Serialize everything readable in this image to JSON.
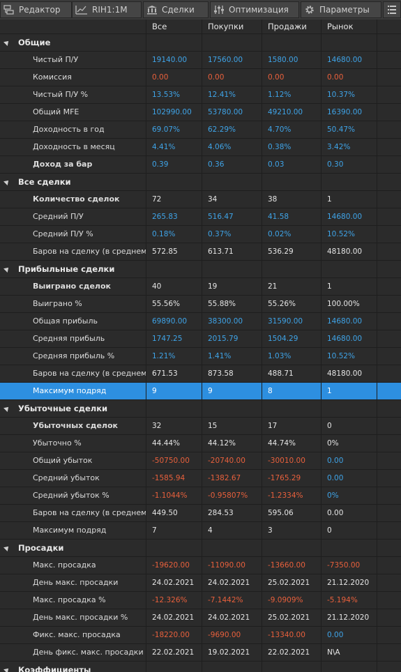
{
  "tabs": [
    {
      "label": "Редактор",
      "icon": "editor-icon"
    },
    {
      "label": "RIH1:1M",
      "icon": "chart-icon"
    },
    {
      "label": "Сделки",
      "icon": "deals-icon"
    },
    {
      "label": "Оптимизация",
      "icon": "optimization-icon"
    },
    {
      "label": "Параметры",
      "icon": "gear-icon"
    }
  ],
  "menu_icon": "list-menu-icon",
  "columns": [
    "",
    "Все",
    "Покупки",
    "Продажи",
    "Рынок"
  ],
  "colors": {
    "positive": "#3fa4e8",
    "negative": "#e8603c",
    "neutral": "#e6e6e6",
    "selection": "#2d8fe0"
  },
  "sections": [
    {
      "title": "Общие",
      "rows": [
        {
          "label": "Чистый П/У",
          "bold": false,
          "values": [
            [
              "19140.00",
              "blue"
            ],
            [
              "17560.00",
              "blue"
            ],
            [
              "1580.00",
              "blue"
            ],
            [
              "14680.00",
              "blue"
            ]
          ]
        },
        {
          "label": "Комиссия",
          "bold": false,
          "values": [
            [
              "0.00",
              "red"
            ],
            [
              "0.00",
              "red"
            ],
            [
              "0.00",
              "red"
            ],
            [
              "0.00",
              "red"
            ]
          ]
        },
        {
          "label": "Чистый П/У %",
          "bold": false,
          "values": [
            [
              "13.53%",
              "blue"
            ],
            [
              "12.41%",
              "blue"
            ],
            [
              "1.12%",
              "blue"
            ],
            [
              "10.37%",
              "blue"
            ]
          ]
        },
        {
          "label": "Общий MFE",
          "bold": false,
          "values": [
            [
              "102990.00",
              "blue"
            ],
            [
              "53780.00",
              "blue"
            ],
            [
              "49210.00",
              "blue"
            ],
            [
              "16390.00",
              "blue"
            ]
          ]
        },
        {
          "label": "Доходность в год",
          "bold": false,
          "values": [
            [
              "69.07%",
              "blue"
            ],
            [
              "62.29%",
              "blue"
            ],
            [
              "4.70%",
              "blue"
            ],
            [
              "50.47%",
              "blue"
            ]
          ]
        },
        {
          "label": "Доходность в месяц",
          "bold": false,
          "values": [
            [
              "4.41%",
              "blue"
            ],
            [
              "4.06%",
              "blue"
            ],
            [
              "0.38%",
              "blue"
            ],
            [
              "3.42%",
              "blue"
            ]
          ]
        },
        {
          "label": "Доход за бар",
          "bold": true,
          "values": [
            [
              "0.39",
              "blue"
            ],
            [
              "0.36",
              "blue"
            ],
            [
              "0.03",
              "blue"
            ],
            [
              "0.30",
              "blue"
            ]
          ]
        }
      ]
    },
    {
      "title": "Все сделки",
      "rows": [
        {
          "label": "Количество сделок",
          "bold": true,
          "values": [
            [
              "72",
              "white"
            ],
            [
              "34",
              "white"
            ],
            [
              "38",
              "white"
            ],
            [
              "1",
              "white"
            ]
          ]
        },
        {
          "label": "Средний П/У",
          "bold": false,
          "values": [
            [
              "265.83",
              "blue"
            ],
            [
              "516.47",
              "blue"
            ],
            [
              "41.58",
              "blue"
            ],
            [
              "14680.00",
              "blue"
            ]
          ]
        },
        {
          "label": "Средний П/У %",
          "bold": false,
          "values": [
            [
              "0.18%",
              "blue"
            ],
            [
              "0.37%",
              "blue"
            ],
            [
              "0.02%",
              "blue"
            ],
            [
              "10.52%",
              "blue"
            ]
          ]
        },
        {
          "label": "Баров на сделку (в среднем)",
          "bold": false,
          "values": [
            [
              "572.85",
              "white"
            ],
            [
              "613.71",
              "white"
            ],
            [
              "536.29",
              "white"
            ],
            [
              "48180.00",
              "white"
            ]
          ]
        }
      ]
    },
    {
      "title": "Прибыльные сделки",
      "rows": [
        {
          "label": "Выиграно сделок",
          "bold": true,
          "values": [
            [
              "40",
              "white"
            ],
            [
              "19",
              "white"
            ],
            [
              "21",
              "white"
            ],
            [
              "1",
              "white"
            ]
          ]
        },
        {
          "label": "Выиграно %",
          "bold": false,
          "values": [
            [
              "55.56%",
              "white"
            ],
            [
              "55.88%",
              "white"
            ],
            [
              "55.26%",
              "white"
            ],
            [
              "100.00%",
              "white"
            ]
          ]
        },
        {
          "label": "Общая прибыль",
          "bold": false,
          "values": [
            [
              "69890.00",
              "blue"
            ],
            [
              "38300.00",
              "blue"
            ],
            [
              "31590.00",
              "blue"
            ],
            [
              "14680.00",
              "blue"
            ]
          ]
        },
        {
          "label": "Средняя прибыль",
          "bold": false,
          "values": [
            [
              "1747.25",
              "blue"
            ],
            [
              "2015.79",
              "blue"
            ],
            [
              "1504.29",
              "blue"
            ],
            [
              "14680.00",
              "blue"
            ]
          ]
        },
        {
          "label": "Средняя прибыль %",
          "bold": false,
          "values": [
            [
              "1.21%",
              "blue"
            ],
            [
              "1.41%",
              "blue"
            ],
            [
              "1.03%",
              "blue"
            ],
            [
              "10.52%",
              "blue"
            ]
          ]
        },
        {
          "label": "Баров на сделку (в среднем)",
          "bold": false,
          "values": [
            [
              "671.53",
              "white"
            ],
            [
              "873.58",
              "white"
            ],
            [
              "488.71",
              "white"
            ],
            [
              "48180.00",
              "white"
            ]
          ]
        },
        {
          "label": "Максимум подряд",
          "bold": false,
          "selected": true,
          "values": [
            [
              "9",
              "white"
            ],
            [
              "9",
              "white"
            ],
            [
              "8",
              "white"
            ],
            [
              "1",
              "white"
            ]
          ]
        }
      ]
    },
    {
      "title": "Убыточные сделки",
      "rows": [
        {
          "label": "Убыточных сделок",
          "bold": true,
          "values": [
            [
              "32",
              "white"
            ],
            [
              "15",
              "white"
            ],
            [
              "17",
              "white"
            ],
            [
              "0",
              "white"
            ]
          ]
        },
        {
          "label": "Убыточно %",
          "bold": false,
          "values": [
            [
              "44.44%",
              "white"
            ],
            [
              "44.12%",
              "white"
            ],
            [
              "44.74%",
              "white"
            ],
            [
              "0%",
              "white"
            ]
          ]
        },
        {
          "label": "Общий убыток",
          "bold": false,
          "values": [
            [
              "-50750.00",
              "red"
            ],
            [
              "-20740.00",
              "red"
            ],
            [
              "-30010.00",
              "red"
            ],
            [
              "0.00",
              "blue"
            ]
          ]
        },
        {
          "label": "Средний убыток",
          "bold": false,
          "values": [
            [
              "-1585.94",
              "red"
            ],
            [
              "-1382.67",
              "red"
            ],
            [
              "-1765.29",
              "red"
            ],
            [
              "0.00",
              "blue"
            ]
          ]
        },
        {
          "label": "Средний убыток %",
          "bold": false,
          "values": [
            [
              "-1.1044%",
              "red"
            ],
            [
              "-0.95807%",
              "red"
            ],
            [
              "-1.2334%",
              "red"
            ],
            [
              "0%",
              "blue"
            ]
          ]
        },
        {
          "label": "Баров на сделку (в среднем)",
          "bold": false,
          "values": [
            [
              "449.50",
              "white"
            ],
            [
              "284.53",
              "white"
            ],
            [
              "595.06",
              "white"
            ],
            [
              "0.00",
              "white"
            ]
          ]
        },
        {
          "label": "Максимум подряд",
          "bold": false,
          "values": [
            [
              "7",
              "white"
            ],
            [
              "4",
              "white"
            ],
            [
              "3",
              "white"
            ],
            [
              "0",
              "white"
            ]
          ]
        }
      ]
    },
    {
      "title": "Просадки",
      "rows": [
        {
          "label": "Макс. просадка",
          "bold": false,
          "values": [
            [
              "-19620.00",
              "red"
            ],
            [
              "-11090.00",
              "red"
            ],
            [
              "-13660.00",
              "red"
            ],
            [
              "-7350.00",
              "red"
            ]
          ]
        },
        {
          "label": "День макс. просадки",
          "bold": false,
          "values": [
            [
              "24.02.2021",
              "white"
            ],
            [
              "24.02.2021",
              "white"
            ],
            [
              "25.02.2021",
              "white"
            ],
            [
              "21.12.2020",
              "white"
            ]
          ]
        },
        {
          "label": "Макс. просадка %",
          "bold": false,
          "values": [
            [
              "-12.326%",
              "red"
            ],
            [
              "-7.1442%",
              "red"
            ],
            [
              "-9.0909%",
              "red"
            ],
            [
              "-5.194%",
              "red"
            ]
          ]
        },
        {
          "label": "День макс. просадки %",
          "bold": false,
          "values": [
            [
              "24.02.2021",
              "white"
            ],
            [
              "24.02.2021",
              "white"
            ],
            [
              "25.02.2021",
              "white"
            ],
            [
              "21.12.2020",
              "white"
            ]
          ]
        },
        {
          "label": "Фикс. макс. просадка",
          "bold": false,
          "values": [
            [
              "-18220.00",
              "red"
            ],
            [
              "-9690.00",
              "red"
            ],
            [
              "-13340.00",
              "red"
            ],
            [
              "0.00",
              "blue"
            ]
          ]
        },
        {
          "label": "День фикс. макс. просадки",
          "bold": false,
          "values": [
            [
              "22.02.2021",
              "white"
            ],
            [
              "19.02.2021",
              "white"
            ],
            [
              "22.02.2021",
              "white"
            ],
            [
              "N\\A",
              "white"
            ]
          ]
        }
      ]
    },
    {
      "title": "Коэффициенты",
      "rows": []
    }
  ]
}
